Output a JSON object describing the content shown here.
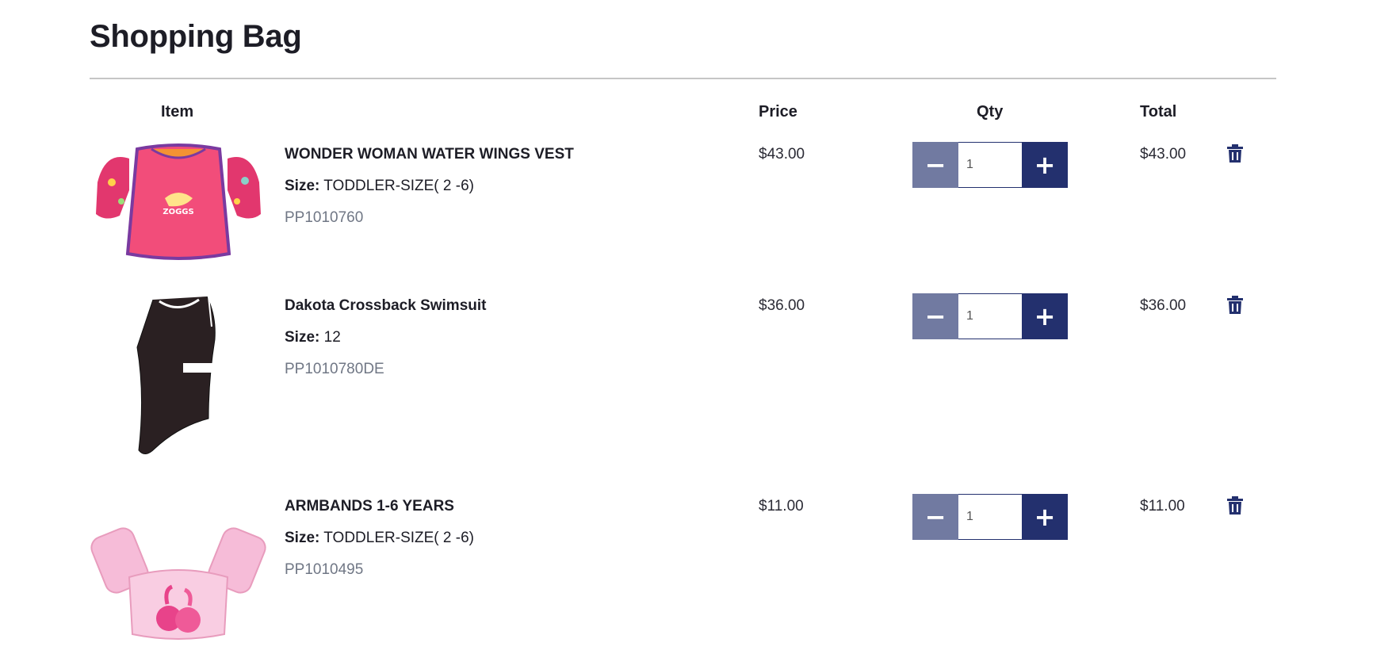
{
  "page": {
    "title": "Shopping Bag"
  },
  "columns": {
    "item": "Item",
    "price": "Price",
    "qty": "Qty",
    "total": "Total"
  },
  "items": [
    {
      "name": "WONDER WOMAN WATER WINGS VEST",
      "size_label": "Size:",
      "size": "TODDLER-SIZE( 2 -6)",
      "sku": "PP1010760",
      "price": "$43.00",
      "qty": "1",
      "total": "$43.00",
      "image": "pink-float-vest-image"
    },
    {
      "name": "Dakota Crossback Swimsuit",
      "size_label": "Size:",
      "size": "12",
      "sku": "PP1010780DE",
      "price": "$36.00",
      "qty": "1",
      "total": "$36.00",
      "image": "black-swimsuit-image"
    },
    {
      "name": "ARMBANDS 1-6 YEARS",
      "size_label": "Size:",
      "size": "TODDLER-SIZE( 2 -6)",
      "sku": "PP1010495",
      "price": "$11.00",
      "qty": "1",
      "total": "$11.00",
      "image": "flamingo-armbands-image"
    }
  ],
  "qty_controls": {
    "minus": "−",
    "plus": "+"
  },
  "icons": {
    "remove": "trash-icon"
  },
  "colors": {
    "primary": "#23306e",
    "minus_button": "#717aa1",
    "divider": "#c6c6c6",
    "sku_text": "#707785"
  }
}
